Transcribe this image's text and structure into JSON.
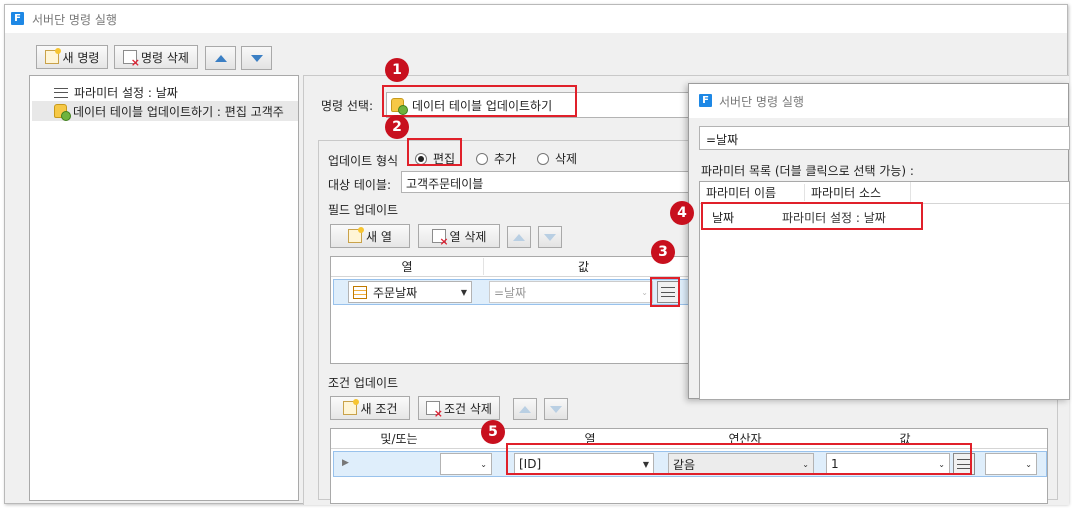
{
  "window": {
    "title": "서버단 명령 실행",
    "app_icon": "F"
  },
  "toolbar": {
    "new_command": "새 명령",
    "delete_command": "명령 삭제"
  },
  "tree": {
    "items": [
      {
        "label": "파라미터 설정 : 날짜",
        "icon": "param-icon"
      },
      {
        "label": "데이터 테이블 업데이트하기 : 편집 고객주",
        "icon": "db-icon"
      }
    ]
  },
  "command": {
    "label": "명령 선택:",
    "value": "데이터 테이블 업데이트하기"
  },
  "update": {
    "type_label": "업데이트 형식",
    "options": [
      "편집",
      "추가",
      "삭제"
    ],
    "selected": "편집",
    "target_label": "대상 테이블:",
    "target_value": "고객주문테이블"
  },
  "field_update": {
    "label": "필드 업데이트",
    "new_column": "새 열",
    "delete_column": "열 삭제",
    "headers": [
      "열",
      "값"
    ],
    "row": {
      "column": "주문날짜",
      "value": "=날짜"
    }
  },
  "condition_update": {
    "label": "조건 업데이트",
    "new_condition": "새 조건",
    "delete_condition": "조건 삭제",
    "headers": [
      "및/또는",
      "열",
      "연산자",
      "값"
    ],
    "row": {
      "andor": "",
      "column": "[ID]",
      "operator": "같음",
      "value": "1",
      "extra": ""
    }
  },
  "popup": {
    "title": "서버단 명령 실행",
    "input_value": "=날짜",
    "list_label": "파라미터 목록 (더블 클릭으로 선택 가능) :",
    "headers": [
      "파라미터 이름",
      "파라미터 소스"
    ],
    "rows": [
      {
        "name": "날짜",
        "source": "파라미터 설정 : 날짜"
      }
    ]
  },
  "badges": [
    "1",
    "2",
    "3",
    "4",
    "5"
  ],
  "colors": {
    "highlight_red": "#e0202a",
    "badge_red": "#c8101e",
    "selection_blue": "#dfeefb",
    "accent_blue": "#3b7fc4"
  }
}
